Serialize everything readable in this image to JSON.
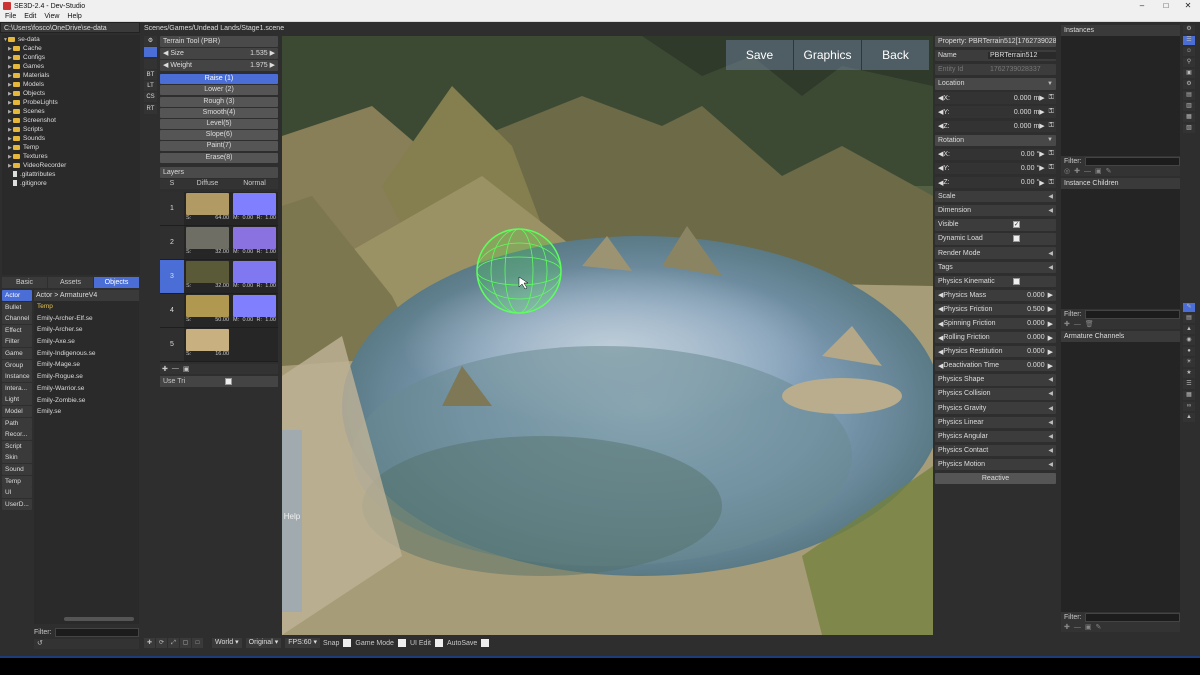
{
  "window": {
    "title": "SE3D-2.4 - Dev-Studio"
  },
  "menu": [
    "File",
    "Edit",
    "View",
    "Help"
  ],
  "left_path": "C:\\Users\\fosco\\OneDrive\\se-data",
  "tree": {
    "root": "se-data",
    "folders": [
      "Cache",
      "Configs",
      "Games",
      "Materials",
      "Models",
      "Objects",
      "ProbeLights",
      "Scenes",
      "Screenshot",
      "Scripts",
      "Sounds",
      "Temp",
      "Textures",
      "VideoRecorder"
    ],
    "files": [
      ".gitattributes",
      ".gitignore"
    ]
  },
  "bottom_tabs": [
    {
      "label": "Basic",
      "active": false
    },
    {
      "label": "Assets",
      "active": false
    },
    {
      "label": "Objects",
      "active": true
    }
  ],
  "categories": [
    {
      "label": "Actor",
      "active": true
    },
    {
      "label": "Bullet"
    },
    {
      "label": "Channel"
    },
    {
      "label": "Effect"
    },
    {
      "label": "Filter"
    },
    {
      "label": "Game"
    },
    {
      "label": "Group"
    },
    {
      "label": "Instance"
    },
    {
      "label": "Intera..."
    },
    {
      "label": "Light"
    },
    {
      "label": "Model"
    },
    {
      "label": "Path"
    },
    {
      "label": "Recor..."
    },
    {
      "label": "Script"
    },
    {
      "label": "Skin"
    },
    {
      "label": "Sound"
    },
    {
      "label": "Temp"
    },
    {
      "label": "UI"
    },
    {
      "label": "UserD..."
    }
  ],
  "actor_list": {
    "header": "Actor > ArmatureV4",
    "items": [
      "Temp",
      "Emily-Archer-Elf.se",
      "Emily-Archer.se",
      "Emily-Axe.se",
      "Emily-Indigenous.se",
      "Emily-Mage.se",
      "Emily-Rogue.se",
      "Emily-Warrior.se",
      "Emily-Zombie.se",
      "Emily.se"
    ]
  },
  "filter_label": "Filter:",
  "scene_path": "Scenes/Games/Undead Lands/Stage1.scene",
  "side_tools": [
    "⚙",
    "",
    "",
    "BT",
    "LT",
    "CS",
    "RT"
  ],
  "terrain_tool": {
    "title": "Terrain Tool (PBR)",
    "size_label": "Size",
    "size_value": "1.535",
    "weight_label": "Weight",
    "weight_value": "1.975",
    "buttons": [
      {
        "label": "Raise (1)",
        "active": true
      },
      {
        "label": "Lower (2)"
      },
      {
        "label": "Rough (3)"
      },
      {
        "label": "Smooth(4)"
      },
      {
        "label": "Level(5)"
      },
      {
        "label": "Slope(6)"
      },
      {
        "label": "Paint(7)"
      },
      {
        "label": "Erase(8)"
      }
    ],
    "layers_title": "Layers",
    "columns": [
      "S",
      "Diffuse",
      "Normal"
    ],
    "layers": [
      {
        "n": "1",
        "s": "64.00",
        "m": "0.00",
        "r": "1.00",
        "diffuse": "#b29a64",
        "normal": "#8080ff",
        "active": false
      },
      {
        "n": "2",
        "s": "32.00",
        "m": "0.00",
        "r": "1.00",
        "diffuse": "#6e6e64",
        "normal": "#8a72e0",
        "active": false
      },
      {
        "n": "3",
        "s": "32.00",
        "m": "0.00",
        "r": "1.00",
        "diffuse": "#5a5a38",
        "normal": "#8078f0",
        "active": true
      },
      {
        "n": "4",
        "s": "50.00",
        "m": "0.00",
        "r": "1.00",
        "diffuse": "#b09850",
        "normal": "#8080ff",
        "active": false
      },
      {
        "n": "5",
        "s": "16.00",
        "m": "",
        "r": "",
        "diffuse": "#c8b080",
        "normal": "",
        "active": false
      }
    ],
    "use_tri_label": "Use Tri"
  },
  "viewport": {
    "buttons": [
      "Save",
      "Graphics",
      "Back"
    ],
    "help": "Help"
  },
  "bottombar": {
    "world": "World",
    "original": "Original",
    "fps": "FPS:60",
    "snap": "Snap",
    "game_mode": "Game Mode",
    "ui_edit": "UI Edit",
    "autosave": "AutoSave"
  },
  "properties": {
    "header": "Property: PBRTerrain512[1762739028337]",
    "name_label": "Name",
    "name_value": "PBRTerrain512",
    "entity_label": "Entity Id",
    "entity_value": "1762739028337",
    "location": "Location",
    "loc": [
      {
        "a": "X:",
        "v": "0.000"
      },
      {
        "a": "Y:",
        "v": "0.000"
      },
      {
        "a": "Z:",
        "v": "0.000"
      }
    ],
    "loc_unit": "m",
    "rotation": "Rotation",
    "rot": [
      {
        "a": "X:",
        "v": "0.00"
      },
      {
        "a": "Y:",
        "v": "0.00"
      },
      {
        "a": "Z:",
        "v": "0.00"
      }
    ],
    "rot_unit": "°",
    "scale": "Scale",
    "dimension": "Dimension",
    "visible": "Visible",
    "dynamic_load": "Dynamic Load",
    "render_mode": "Render Mode",
    "tags": "Tags",
    "physics_kinematic": "Physics Kinematic",
    "physics_values": [
      {
        "label": "Physics Mass",
        "value": "0.000"
      },
      {
        "label": "Physics Friction",
        "value": "0.500"
      },
      {
        "label": "Spinning Friction",
        "value": "0.000"
      },
      {
        "label": "Rolling Friction",
        "value": "0.000"
      },
      {
        "label": "Physics Restitution",
        "value": "0.000"
      },
      {
        "label": "Deactivation Time",
        "value": "0.000"
      }
    ],
    "physics_groups": [
      "Physics Shape",
      "Physics Collision",
      "Physics Gravity",
      "Physics Linear",
      "Physics Angular",
      "Physics Contact",
      "Physics Motion"
    ],
    "reactive": "Reactive"
  },
  "right": {
    "instances": "Instances",
    "instance_children": "Instance Children",
    "armature_channels": "Armature Channels"
  }
}
